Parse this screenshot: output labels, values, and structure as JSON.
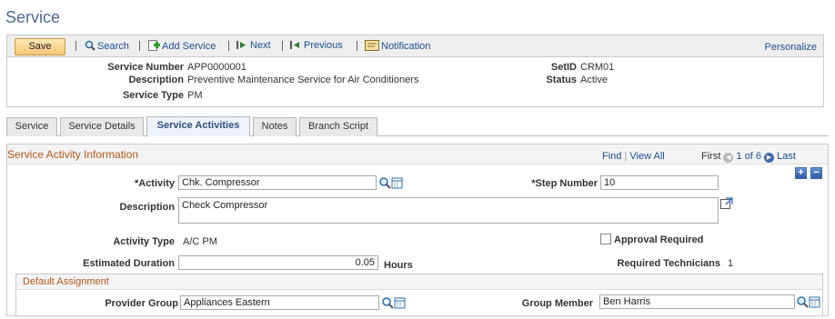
{
  "page": {
    "title": "Service"
  },
  "toolbar": {
    "save_label": "Save",
    "search_label": "Search",
    "add_service_label": "Add Service",
    "next_label": "Next",
    "previous_label": "Previous",
    "notification_label": "Notification",
    "personalize_label": "Personalize"
  },
  "header": {
    "service_number_label": "Service Number",
    "service_number_value": "APP0000001",
    "description_label": "Description",
    "description_value": "Preventive Maintenance Service for Air Conditioners",
    "service_type_label": "Service Type",
    "service_type_value": "PM",
    "setid_label": "SetID",
    "setid_value": "CRM01",
    "status_label": "Status",
    "status_value": "Active"
  },
  "tabs": [
    {
      "label": "Service",
      "active": false
    },
    {
      "label": "Service Details",
      "active": false
    },
    {
      "label": "Service Activities",
      "active": true
    },
    {
      "label": "Notes",
      "active": false
    },
    {
      "label": "Branch Script",
      "active": false
    }
  ],
  "section": {
    "title": "Service Activity Information",
    "find_label": "Find",
    "view_all_label": "View All",
    "first_label": "First",
    "page_indicator": "1 of 6",
    "last_label": "Last",
    "add_row_symbol": "+",
    "delete_row_symbol": "−"
  },
  "form": {
    "activity_label": "*Activity",
    "activity_value": "Chk. Compressor",
    "step_number_label": "*Step Number",
    "step_number_value": "10",
    "description_label": "Description",
    "description_value": "Check Compressor",
    "activity_type_label": "Activity Type",
    "activity_type_value": "A/C PM",
    "approval_required_label": "Approval Required",
    "approval_required_checked": false,
    "estimated_duration_label": "Estimated Duration",
    "estimated_duration_value": "0.05",
    "hours_label": "Hours",
    "required_technicians_label": "Required Technicians",
    "required_technicians_value": "1"
  },
  "default_assignment": {
    "title": "Default Assignment",
    "provider_group_label": "Provider Group",
    "provider_group_value": "Appliances Eastern",
    "group_member_label": "Group Member",
    "group_member_value": "Ben Harris"
  },
  "colors": {
    "link": "#1d4f91",
    "section_title": "#b2561b",
    "page_title": "#4b6a96",
    "save_button": "#f6c676"
  }
}
